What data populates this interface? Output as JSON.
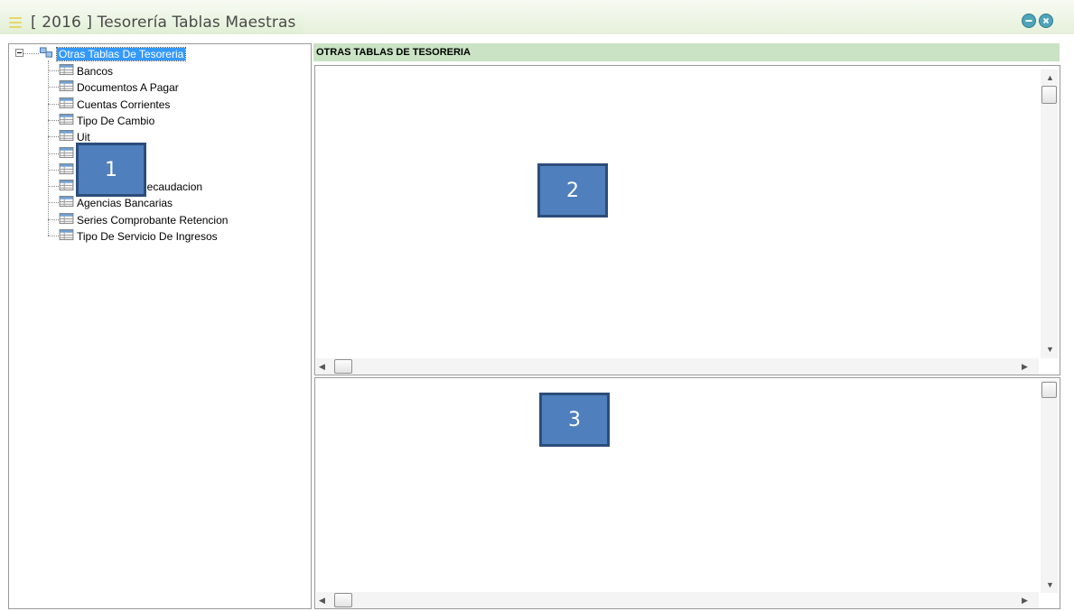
{
  "window": {
    "title": "[ 2016 ] Tesorería Tablas Maestras"
  },
  "tree": {
    "root_label": "Otras Tablas De Tesoreria",
    "items": [
      {
        "label": "Bancos"
      },
      {
        "label": "Documentos A Pagar"
      },
      {
        "label": "Cuentas Corrientes"
      },
      {
        "label": "Tipo De Cambio"
      },
      {
        "label": "Uit"
      },
      {
        "label": ""
      },
      {
        "label": ""
      },
      {
        "label": "Recaudacion"
      },
      {
        "label": "Agencias Bancarias"
      },
      {
        "label": "Series Comprobante Retencion"
      },
      {
        "label": "Tipo De Servicio De Ingresos"
      }
    ]
  },
  "section": {
    "header": "OTRAS TABLAS DE TESORERIA"
  },
  "callouts": {
    "one": "1",
    "two": "2",
    "three": "3"
  },
  "colors": {
    "header_bg": "#c9e3c4",
    "selection": "#3399ff",
    "callout_fill": "#4f7fbd",
    "callout_border": "#2c4d7a"
  }
}
